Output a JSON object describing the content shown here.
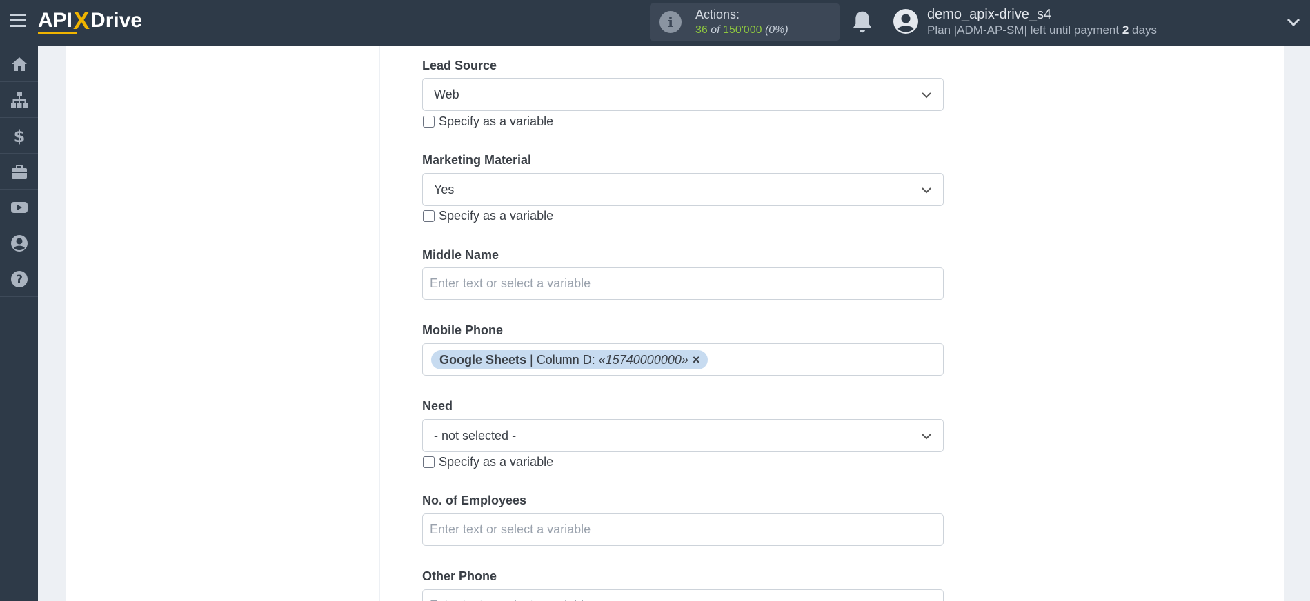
{
  "header": {
    "logo_left": "API",
    "logo_x": "X",
    "logo_right": "Drive",
    "actions_label": "Actions:",
    "actions_used": "36",
    "actions_of": "of",
    "actions_total": "150'000",
    "actions_percent": "(0%)",
    "username": "demo_apix-drive_s4",
    "plan_prefix": "Plan |ADM-AP-SM| left until payment",
    "plan_days_num": "2",
    "plan_days_word": "days"
  },
  "sidebar": {
    "items": [
      "home-icon",
      "sitemap-icon",
      "dollar-icon",
      "briefcase-icon",
      "youtube-icon",
      "user-circle-icon",
      "question-circle-icon"
    ]
  },
  "form": {
    "lead_source": {
      "label": "Lead Source",
      "value": "Web",
      "checkbox_label": "Specify as a variable"
    },
    "marketing_material": {
      "label": "Marketing Material",
      "value": "Yes",
      "checkbox_label": "Specify as a variable"
    },
    "middle_name": {
      "label": "Middle Name",
      "placeholder": "Enter text or select a variable"
    },
    "mobile_phone": {
      "label": "Mobile Phone",
      "tag_source": "Google Sheets",
      "tag_column": "| Column D:",
      "tag_value": "«15740000000»",
      "tag_remove": "×"
    },
    "need": {
      "label": "Need",
      "value": "- not selected -",
      "checkbox_label": "Specify as a variable"
    },
    "employees": {
      "label": "No. of Employees",
      "placeholder": "Enter text or select a variable"
    },
    "other_phone": {
      "label": "Other Phone",
      "placeholder": "Enter text or select a variable"
    }
  },
  "colors": {
    "topbar": "#2e3a48",
    "accent_yellow": "#f0b400",
    "accent_green": "#8dc63f",
    "tag_bg": "#c7dbf0"
  }
}
